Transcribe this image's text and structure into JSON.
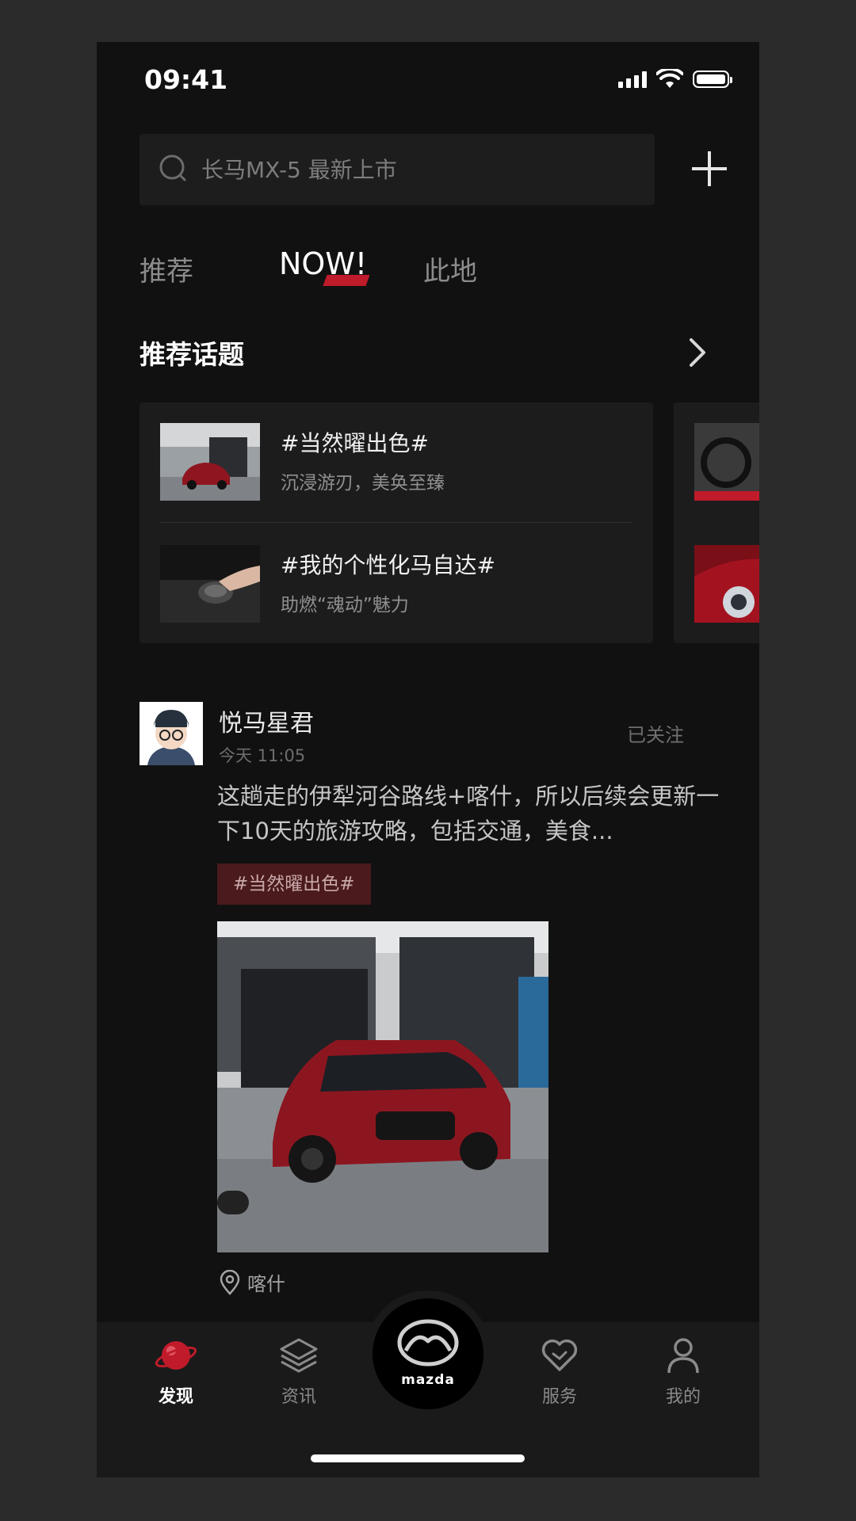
{
  "status_bar": {
    "time": "09:41"
  },
  "search": {
    "placeholder": "长马MX-5 最新上市"
  },
  "tabs": [
    {
      "label": "推荐"
    },
    {
      "label": "NOW!"
    },
    {
      "label": "此地"
    }
  ],
  "active_tab": "NOW!",
  "section": {
    "title": "推荐话题"
  },
  "topics": [
    {
      "title": "#当然曜出色#",
      "subtitle": "沉浸游刃，美奂至臻"
    },
    {
      "title": "#我的个性化马自达#",
      "subtitle": "助燃“魂动”魅力"
    }
  ],
  "post": {
    "username": "悦马星君",
    "time": "今天 11:05",
    "follow_status": "已关注",
    "text": "这趟走的伊犁河谷路线+喀什，所以后续会更新一下10天的旅游攻略，包括交通，美食...",
    "tag": "#当然曜出色#",
    "location": "喀什"
  },
  "bottom_nav": [
    {
      "label": "发现",
      "icon": "planet-icon",
      "active": true
    },
    {
      "label": "资讯",
      "icon": "layers-icon",
      "active": false
    },
    {
      "label": "mazda",
      "icon": "mazda-logo-icon",
      "active": false
    },
    {
      "label": "服务",
      "icon": "heart-icon",
      "active": false
    },
    {
      "label": "我的",
      "icon": "person-icon",
      "active": false
    }
  ],
  "colors": {
    "accent": "#c01b2a",
    "background": "#111111",
    "card": "#1c1c1c"
  }
}
